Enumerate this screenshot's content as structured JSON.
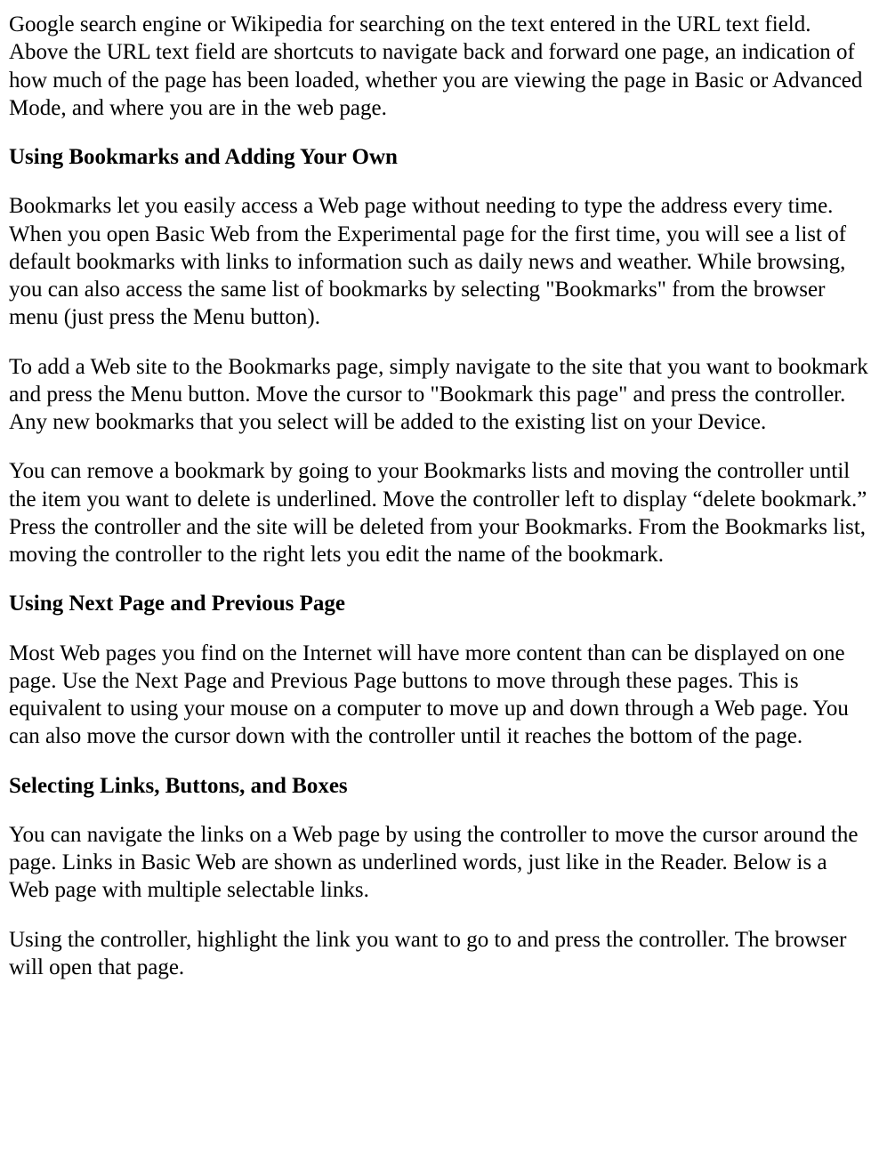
{
  "paragraphs": {
    "intro": "Google search engine or Wikipedia for searching on the text entered in the URL text field. Above the URL text field are shortcuts to navigate back and forward one page, an indication of how much of the page has been loaded, whether you are viewing the page in Basic or Advanced Mode, and where you are in the web page.",
    "bookmarks_heading": "Using Bookmarks and Adding Your Own",
    "bookmarks_p1": "Bookmarks let you easily access a Web page without needing to type the address every time. When you open Basic Web from the Experimental page for the first time, you will see a list of default bookmarks with links to information such as daily news and weather. While browsing, you can also access the same list of bookmarks by selecting \"Bookmarks\" from the browser menu (just press the Menu button).",
    "bookmarks_p2": "To add a Web site to the Bookmarks page, simply navigate to the site that you want to bookmark and press the Menu button. Move the cursor to \"Bookmark this page\" and press the controller. Any new bookmarks that you select will be added to the existing list on your Device.",
    "bookmarks_p3": "You can remove a bookmark by going to your Bookmarks lists and moving the controller until the item you want to delete is underlined. Move the controller left to display “delete bookmark.” Press the controller and the site will be deleted from your Bookmarks. From the Bookmarks list, moving the controller to the right lets you edit the name of the bookmark.",
    "nextprev_heading": "Using Next Page and Previous Page",
    "nextprev_p1": "Most Web pages you find on the Internet will have more content than can be displayed on one page. Use the Next Page and Previous Page buttons to move through these pages. This is equivalent to using your mouse on a computer to move up and down through a Web page. You can also move the cursor down with the controller until it reaches the bottom of the page.",
    "links_heading": "Selecting Links, Buttons, and Boxes",
    "links_p1": "You can navigate the links on a Web page by using the controller to move the cursor around the page. Links in Basic Web are shown as underlined words, just like in the Reader. Below is a Web page with multiple selectable links.",
    "links_p2": "Using the controller, highlight the link you want to go to and press the controller. The browser will open that page."
  }
}
